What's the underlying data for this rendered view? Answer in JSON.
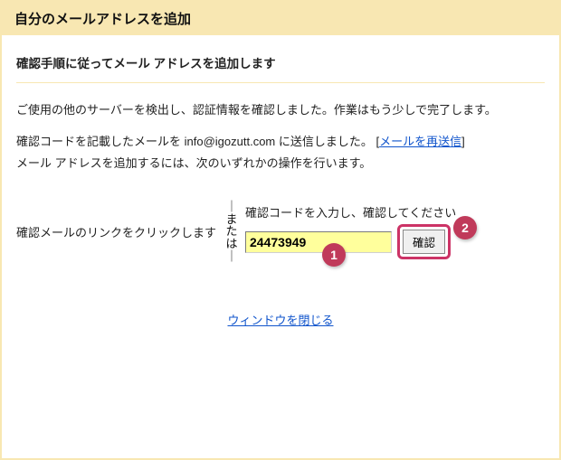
{
  "header": {
    "title": "自分のメールアドレスを追加"
  },
  "section": {
    "title": "確認手順に従ってメール アドレスを追加します"
  },
  "body": {
    "line1": "ご使用の他のサーバーを検出し、認証情報を確認しました。作業はもう少しで完了します。",
    "line2_prefix": "確認コードを記載したメールを ",
    "email": "info@igozutt.com",
    "line2_suffix": " に送信しました。 [",
    "resend_link": "メールを再送信",
    "line2_close": "]",
    "line3": "メール アドレスを追加するには、次のいずれかの操作を行います。"
  },
  "verify": {
    "left_label": "確認メールのリンクをクリックします",
    "or": {
      "c1": "｜",
      "c2": "ま",
      "c3": "た",
      "c4": "は",
      "c5": "｜"
    },
    "right_label": "確認コードを入力し、確認してください",
    "code_value": "24473949",
    "confirm_label": "確認"
  },
  "callouts": {
    "one": "1",
    "two": "2"
  },
  "footer": {
    "close_link": "ウィンドウを閉じる"
  }
}
